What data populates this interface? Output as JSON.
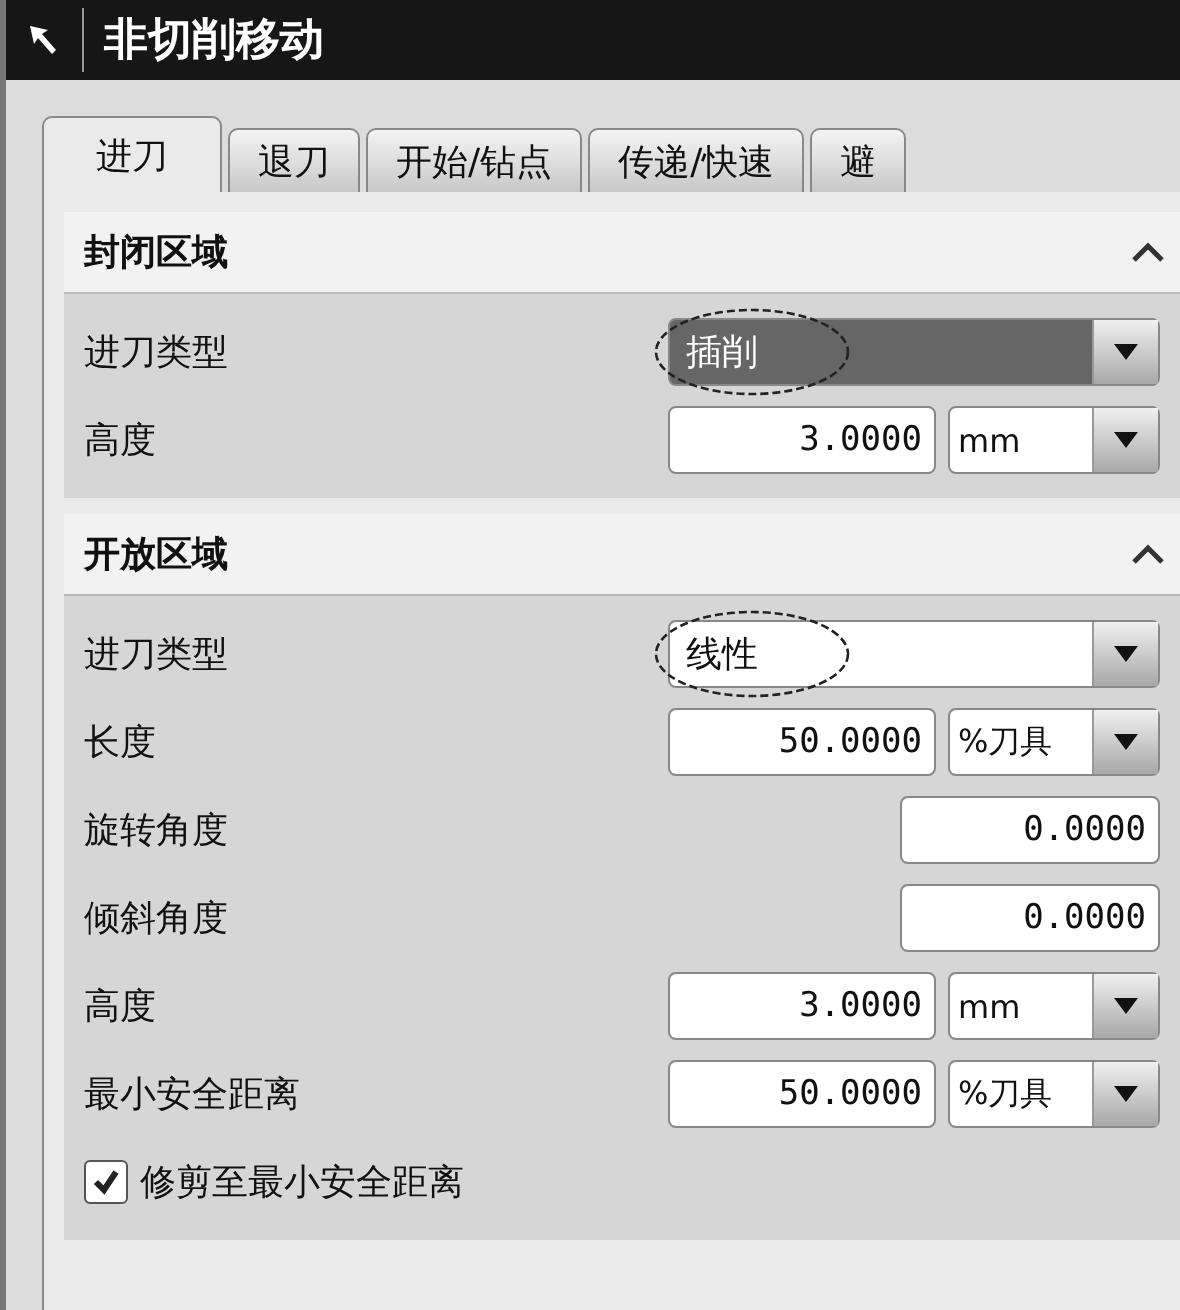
{
  "window": {
    "title": "非切削移动"
  },
  "tabs": [
    {
      "label": "进刀",
      "selected": true
    },
    {
      "label": "退刀",
      "selected": false
    },
    {
      "label": "开始/钻点",
      "selected": false
    },
    {
      "label": "传递/快速",
      "selected": false
    },
    {
      "label": "避",
      "selected": false
    }
  ],
  "sections": [
    {
      "title": "封闭区域",
      "expanded": true,
      "rows": [
        {
          "kind": "dropdown",
          "label": "进刀类型",
          "value": "插削",
          "focused": true,
          "circled": true
        },
        {
          "kind": "number_unit",
          "label": "高度",
          "value": "3.0000",
          "unit": "mm"
        }
      ]
    },
    {
      "title": "开放区域",
      "expanded": true,
      "rows": [
        {
          "kind": "dropdown",
          "label": "进刀类型",
          "value": "线性",
          "focused": false,
          "circled": true
        },
        {
          "kind": "number_unit",
          "label": "长度",
          "value": "50.0000",
          "unit": "%刀具"
        },
        {
          "kind": "number",
          "label": "旋转角度",
          "value": "0.0000"
        },
        {
          "kind": "number",
          "label": "倾斜角度",
          "value": "0.0000"
        },
        {
          "kind": "number_unit",
          "label": "高度",
          "value": "3.0000",
          "unit": "mm"
        },
        {
          "kind": "number_unit",
          "label": "最小安全距离",
          "value": "50.0000",
          "unit": "%刀具"
        },
        {
          "kind": "checkbox",
          "label": "修剪至最小安全距离",
          "checked": true
        }
      ]
    }
  ]
}
